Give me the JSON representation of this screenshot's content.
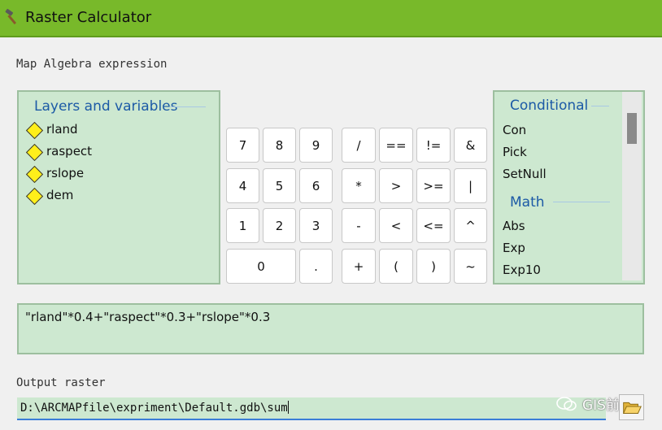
{
  "window": {
    "title": "Raster Calculator",
    "icon": "hammer-icon"
  },
  "expression_label": "Map Algebra expression",
  "layers_panel": {
    "heading": "Layers and variables",
    "items": [
      {
        "label": "rland",
        "icon": "raster-layer-diamond-icon"
      },
      {
        "label": "raspect",
        "icon": "raster-layer-diamond-icon"
      },
      {
        "label": "rslope",
        "icon": "raster-layer-diamond-icon"
      },
      {
        "label": "dem",
        "icon": "raster-layer-diamond-icon"
      }
    ]
  },
  "keypad": {
    "digits": [
      "7",
      "8",
      "9",
      "4",
      "5",
      "6",
      "1",
      "2",
      "3",
      "0",
      "."
    ],
    "operators": [
      "/",
      "==",
      "!=",
      "&",
      "*",
      ">",
      ">=",
      "|",
      "-",
      "<",
      "<=",
      "^",
      "+",
      "(",
      ")",
      "~"
    ]
  },
  "functions_panel": {
    "conditional_heading": "Conditional",
    "conditional": [
      "Con",
      "Pick",
      "SetNull"
    ],
    "math_heading": "Math",
    "math": [
      "Abs",
      "Exp",
      "Exp10"
    ]
  },
  "expression": "\"rland\"*0.4+\"raspect\"*0.3+\"rslope\"*0.3",
  "output_label": "Output raster",
  "output_value": "D:\\ARCMAPfile\\expriment\\Default.gdb\\sum",
  "watermark": "GIS前沿",
  "colors": {
    "titlebar": "#78b92a",
    "panel_bg": "#cde8d0",
    "heading": "#1c5aa6",
    "input_focus": "#3b7dd8"
  }
}
